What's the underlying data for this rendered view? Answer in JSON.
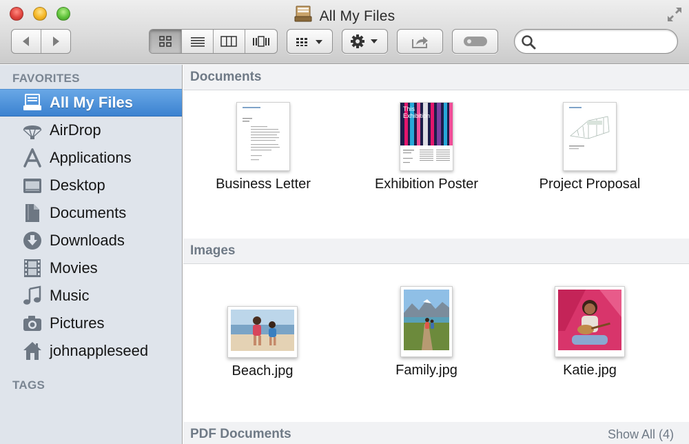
{
  "window": {
    "title": "All My Files",
    "search_placeholder": ""
  },
  "sidebar": {
    "favorites_heading": "FAVORITES",
    "tags_heading": "TAGS",
    "items": [
      {
        "label": "All My Files",
        "icon": "all-my-files-icon",
        "selected": true
      },
      {
        "label": "AirDrop",
        "icon": "airdrop-icon"
      },
      {
        "label": "Applications",
        "icon": "applications-icon"
      },
      {
        "label": "Desktop",
        "icon": "desktop-icon"
      },
      {
        "label": "Documents",
        "icon": "documents-icon"
      },
      {
        "label": "Downloads",
        "icon": "downloads-icon"
      },
      {
        "label": "Movies",
        "icon": "movies-icon"
      },
      {
        "label": "Music",
        "icon": "music-icon"
      },
      {
        "label": "Pictures",
        "icon": "pictures-icon"
      },
      {
        "label": "johnappleseed",
        "icon": "home-icon"
      }
    ]
  },
  "sections": {
    "documents": {
      "title": "Documents",
      "files": [
        {
          "name": "Business Letter"
        },
        {
          "name": "Exhibition Poster",
          "thumb_text": "This Exhibition"
        },
        {
          "name": "Project Proposal"
        }
      ]
    },
    "images": {
      "title": "Images",
      "files": [
        {
          "name": "Beach.jpg"
        },
        {
          "name": "Family.jpg"
        },
        {
          "name": "Katie.jpg"
        }
      ]
    },
    "pdf": {
      "title": "PDF Documents",
      "show_all": "Show All (4)"
    }
  },
  "colors": {
    "selection": "#3b82d0",
    "sidebar_bg": "#dfe4eb",
    "section_header_text": "#6f7a86"
  }
}
